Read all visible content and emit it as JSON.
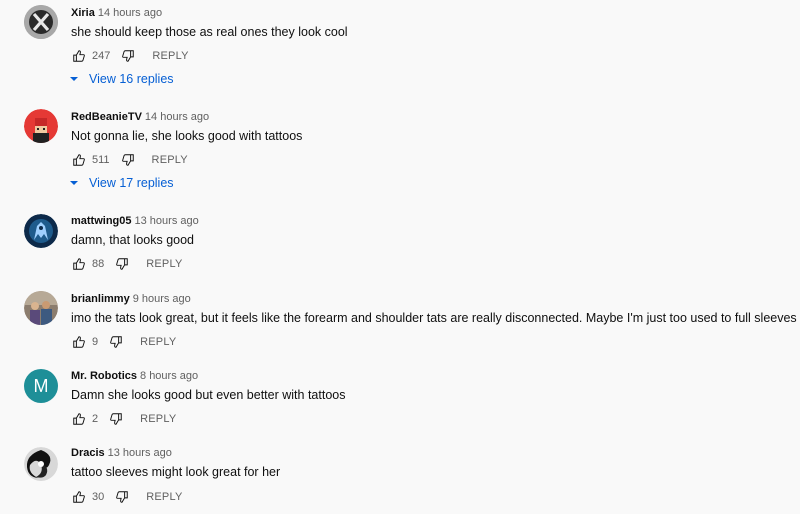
{
  "comments": [
    {
      "author": "Xiria",
      "time": "14 hours ago",
      "text": "she should keep those as real ones they look cool",
      "likes": "247",
      "reply": "REPLY",
      "replies": "View 16 replies",
      "avatar": "x-logo-avatar"
    },
    {
      "author": "RedBeanieTV",
      "time": "14 hours ago",
      "text": "Not gonna lie, she looks good with tattoos",
      "likes": "511",
      "reply": "REPLY",
      "replies": "View 17 replies",
      "avatar": "red-beanie-avatar"
    },
    {
      "author": "mattwing05",
      "time": "13 hours ago",
      "text": "damn, that looks good",
      "likes": "88",
      "reply": "REPLY",
      "avatar": "blue-creature-avatar"
    },
    {
      "author": "brianlimmy",
      "time": "9 hours ago",
      "text": "imo the tats look great, but it feels like the forearm and shoulder tats are really disconnected. Maybe I'm just too used to full sleeves",
      "likes": "9",
      "reply": "REPLY",
      "avatar": "photo-avatar"
    },
    {
      "author": "Mr. Robotics",
      "time": "8 hours ago",
      "text": "Damn she looks good but even better with tattoos",
      "likes": "2",
      "reply": "REPLY",
      "avatar": "letter-m-avatar",
      "avatar_letter": "M"
    },
    {
      "author": "Dracis",
      "time": "13 hours ago",
      "text": "tattoo sleeves might look great for her",
      "likes": "30",
      "reply": "REPLY",
      "avatar": "bw-swirl-avatar"
    }
  ],
  "colors": {
    "link": "#065fd4",
    "muted": "#606060",
    "avatar_m": "#1e8f98"
  }
}
